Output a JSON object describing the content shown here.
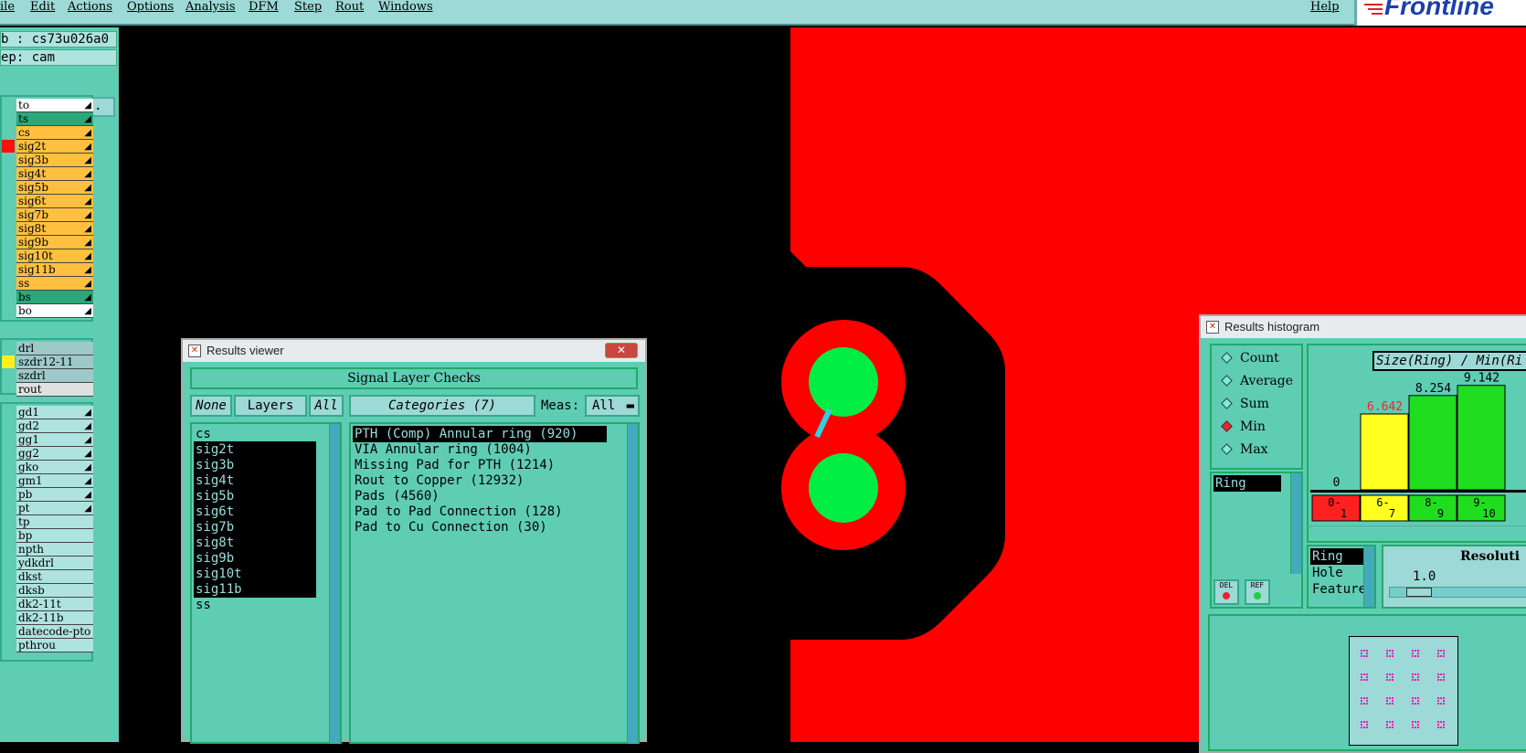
{
  "menu": {
    "items": [
      "ile",
      "Edit",
      "Actions",
      "Options",
      "Analysis",
      "DFM",
      "Step",
      "Rout",
      "Windows"
    ],
    "help": "Help",
    "logo": "Frontline"
  },
  "job": {
    "job_label": "b : cs73u026a0",
    "step_label": "ep: cam",
    "matrix_button": "ob Matrix ..."
  },
  "layers_board": [
    {
      "name": "to",
      "color": "#ffffff"
    },
    {
      "name": "ts",
      "color": "#2aa87a"
    },
    {
      "name": "cs",
      "color": "#ffc040"
    },
    {
      "name": "sig2t",
      "color": "#ffc040"
    },
    {
      "name": "sig3b",
      "color": "#ffc040"
    },
    {
      "name": "sig4t",
      "color": "#ffc040"
    },
    {
      "name": "sig5b",
      "color": "#ffc040"
    },
    {
      "name": "sig6t",
      "color": "#ffc040"
    },
    {
      "name": "sig7b",
      "color": "#ffc040"
    },
    {
      "name": "sig8t",
      "color": "#ffc040"
    },
    {
      "name": "sig9b",
      "color": "#ffc040"
    },
    {
      "name": "sig10t",
      "color": "#ffc040"
    },
    {
      "name": "sig11b",
      "color": "#ffc040"
    },
    {
      "name": "ss",
      "color": "#ffc040"
    },
    {
      "name": "bs",
      "color": "#2aa87a"
    },
    {
      "name": "bo",
      "color": "#ffffff"
    }
  ],
  "layers_drill": [
    {
      "name": "drl",
      "color": "#9dc9c9"
    },
    {
      "name": "szdr12-11",
      "color": "#9dc9c9"
    },
    {
      "name": "szdrl",
      "color": "#9dc9c9"
    },
    {
      "name": "rout",
      "color": "#e0e0e0"
    }
  ],
  "layers_misc": [
    "gd1",
    "gd2",
    "gg1",
    "gg2",
    "gko",
    "gm1",
    "pb",
    "pt",
    "tp",
    "bp",
    "npth",
    "ydkdrl",
    "dkst",
    "dksb",
    "dk2-11t",
    "dk2-11b",
    "datecode-pto",
    "pthrou"
  ],
  "results_viewer": {
    "title": "Results viewer",
    "close": "✕",
    "header": "Signal Layer Checks",
    "none_btn": "None",
    "layers_btn": "Layers",
    "all_btn": "All",
    "categories_btn": "Categories (7)",
    "meas_label": "Meas:",
    "meas_value": "All",
    "layers": [
      {
        "name": "cs",
        "selected": false
      },
      {
        "name": "sig2t",
        "selected": true
      },
      {
        "name": "sig3b",
        "selected": true
      },
      {
        "name": "sig4t",
        "selected": true
      },
      {
        "name": "sig5b",
        "selected": true
      },
      {
        "name": "sig6t",
        "selected": true
      },
      {
        "name": "sig7b",
        "selected": true
      },
      {
        "name": "sig8t",
        "selected": true
      },
      {
        "name": "sig9b",
        "selected": true
      },
      {
        "name": "sig10t",
        "selected": true
      },
      {
        "name": "sig11b",
        "selected": true
      },
      {
        "name": "ss",
        "selected": false
      }
    ],
    "categories": [
      {
        "name": "PTH (Comp) Annular ring (920)",
        "selected": true
      },
      {
        "name": "VIA Annular ring (1004)",
        "selected": false
      },
      {
        "name": "Missing Pad for PTH (1214)",
        "selected": false
      },
      {
        "name": "Rout to Copper (12932)",
        "selected": false
      },
      {
        "name": "Pads (4560)",
        "selected": false
      },
      {
        "name": "Pad to Pad Connection (128)",
        "selected": false
      },
      {
        "name": "Pad to Cu Connection (30)",
        "selected": false
      }
    ]
  },
  "histogram": {
    "title": "Results histogram",
    "options": [
      {
        "label": "Count",
        "on": false
      },
      {
        "label": "Average",
        "on": false
      },
      {
        "label": "Sum",
        "on": false
      },
      {
        "label": "Min",
        "on": true
      },
      {
        "label": "Max",
        "on": false
      }
    ],
    "measure_list": [
      "Ring"
    ],
    "del_btn": "DEL",
    "ref_btn": "REF",
    "chart_title": "Size(Ring) / Min(Ri",
    "attr_list": [
      "Ring",
      "Hole",
      "Feature"
    ],
    "resolution_label": "Resoluti",
    "resolution_value": "1.0"
  },
  "chart_data": {
    "type": "bar",
    "title": "Size(Ring) / Min(Ri",
    "categories": [
      "0-1",
      "6-7",
      "8-9",
      "9-10"
    ],
    "category_labels": [
      [
        "0-",
        "1"
      ],
      [
        "6-",
        "7"
      ],
      [
        "8-",
        "9"
      ],
      [
        "9-",
        "10"
      ]
    ],
    "values": [
      0,
      6.642,
      8.254,
      9.142
    ],
    "value_labels": [
      "0",
      "6.642",
      "8.254",
      "9.142"
    ],
    "colors": [
      "#ff2020",
      "#ffff20",
      "#20dd20",
      "#20dd20"
    ],
    "ylim": [
      0,
      10
    ]
  }
}
